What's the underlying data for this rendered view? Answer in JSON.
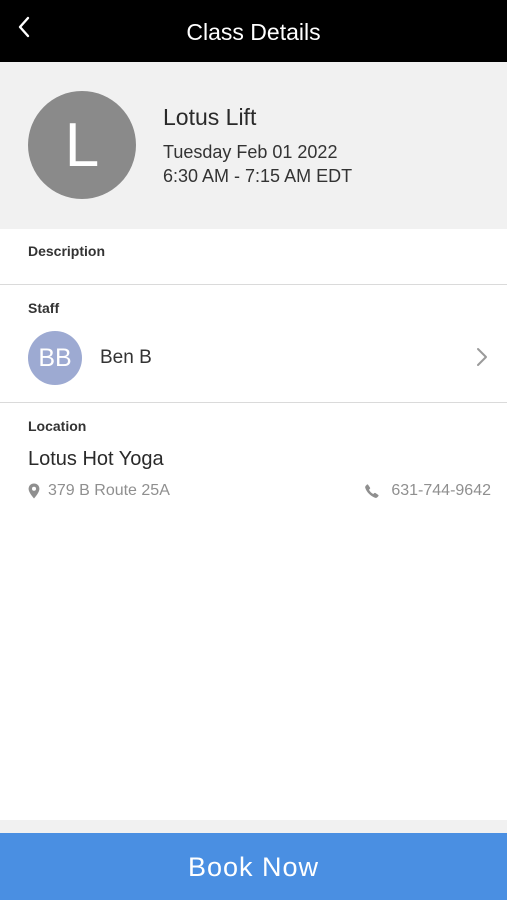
{
  "header": {
    "title": "Class Details",
    "back_icon": "chevron-left-icon"
  },
  "class_info": {
    "avatar_initial": "L",
    "name": "Lotus Lift",
    "date": "Tuesday Feb 01 2022",
    "time": "6:30 AM - 7:15 AM EDT"
  },
  "description": {
    "label": "Description"
  },
  "staff": {
    "label": "Staff",
    "avatar_initials": "BB",
    "name": "Ben B",
    "chevron_icon": "chevron-right-icon"
  },
  "location": {
    "label": "Location",
    "name": "Lotus Hot Yoga",
    "address": "379 B Route 25A",
    "address_icon": "map-pin-icon",
    "phone": "631-744-9642",
    "phone_icon": "phone-icon"
  },
  "footer": {
    "book_label": "Book Now"
  },
  "colors": {
    "header_bg": "#000000",
    "summary_bg": "#f1f1f1",
    "class_avatar_bg": "#8a8a8a",
    "staff_avatar_bg": "#9daad2",
    "book_button_bg": "#4a8fe2",
    "muted_text": "#8f8f8f"
  }
}
